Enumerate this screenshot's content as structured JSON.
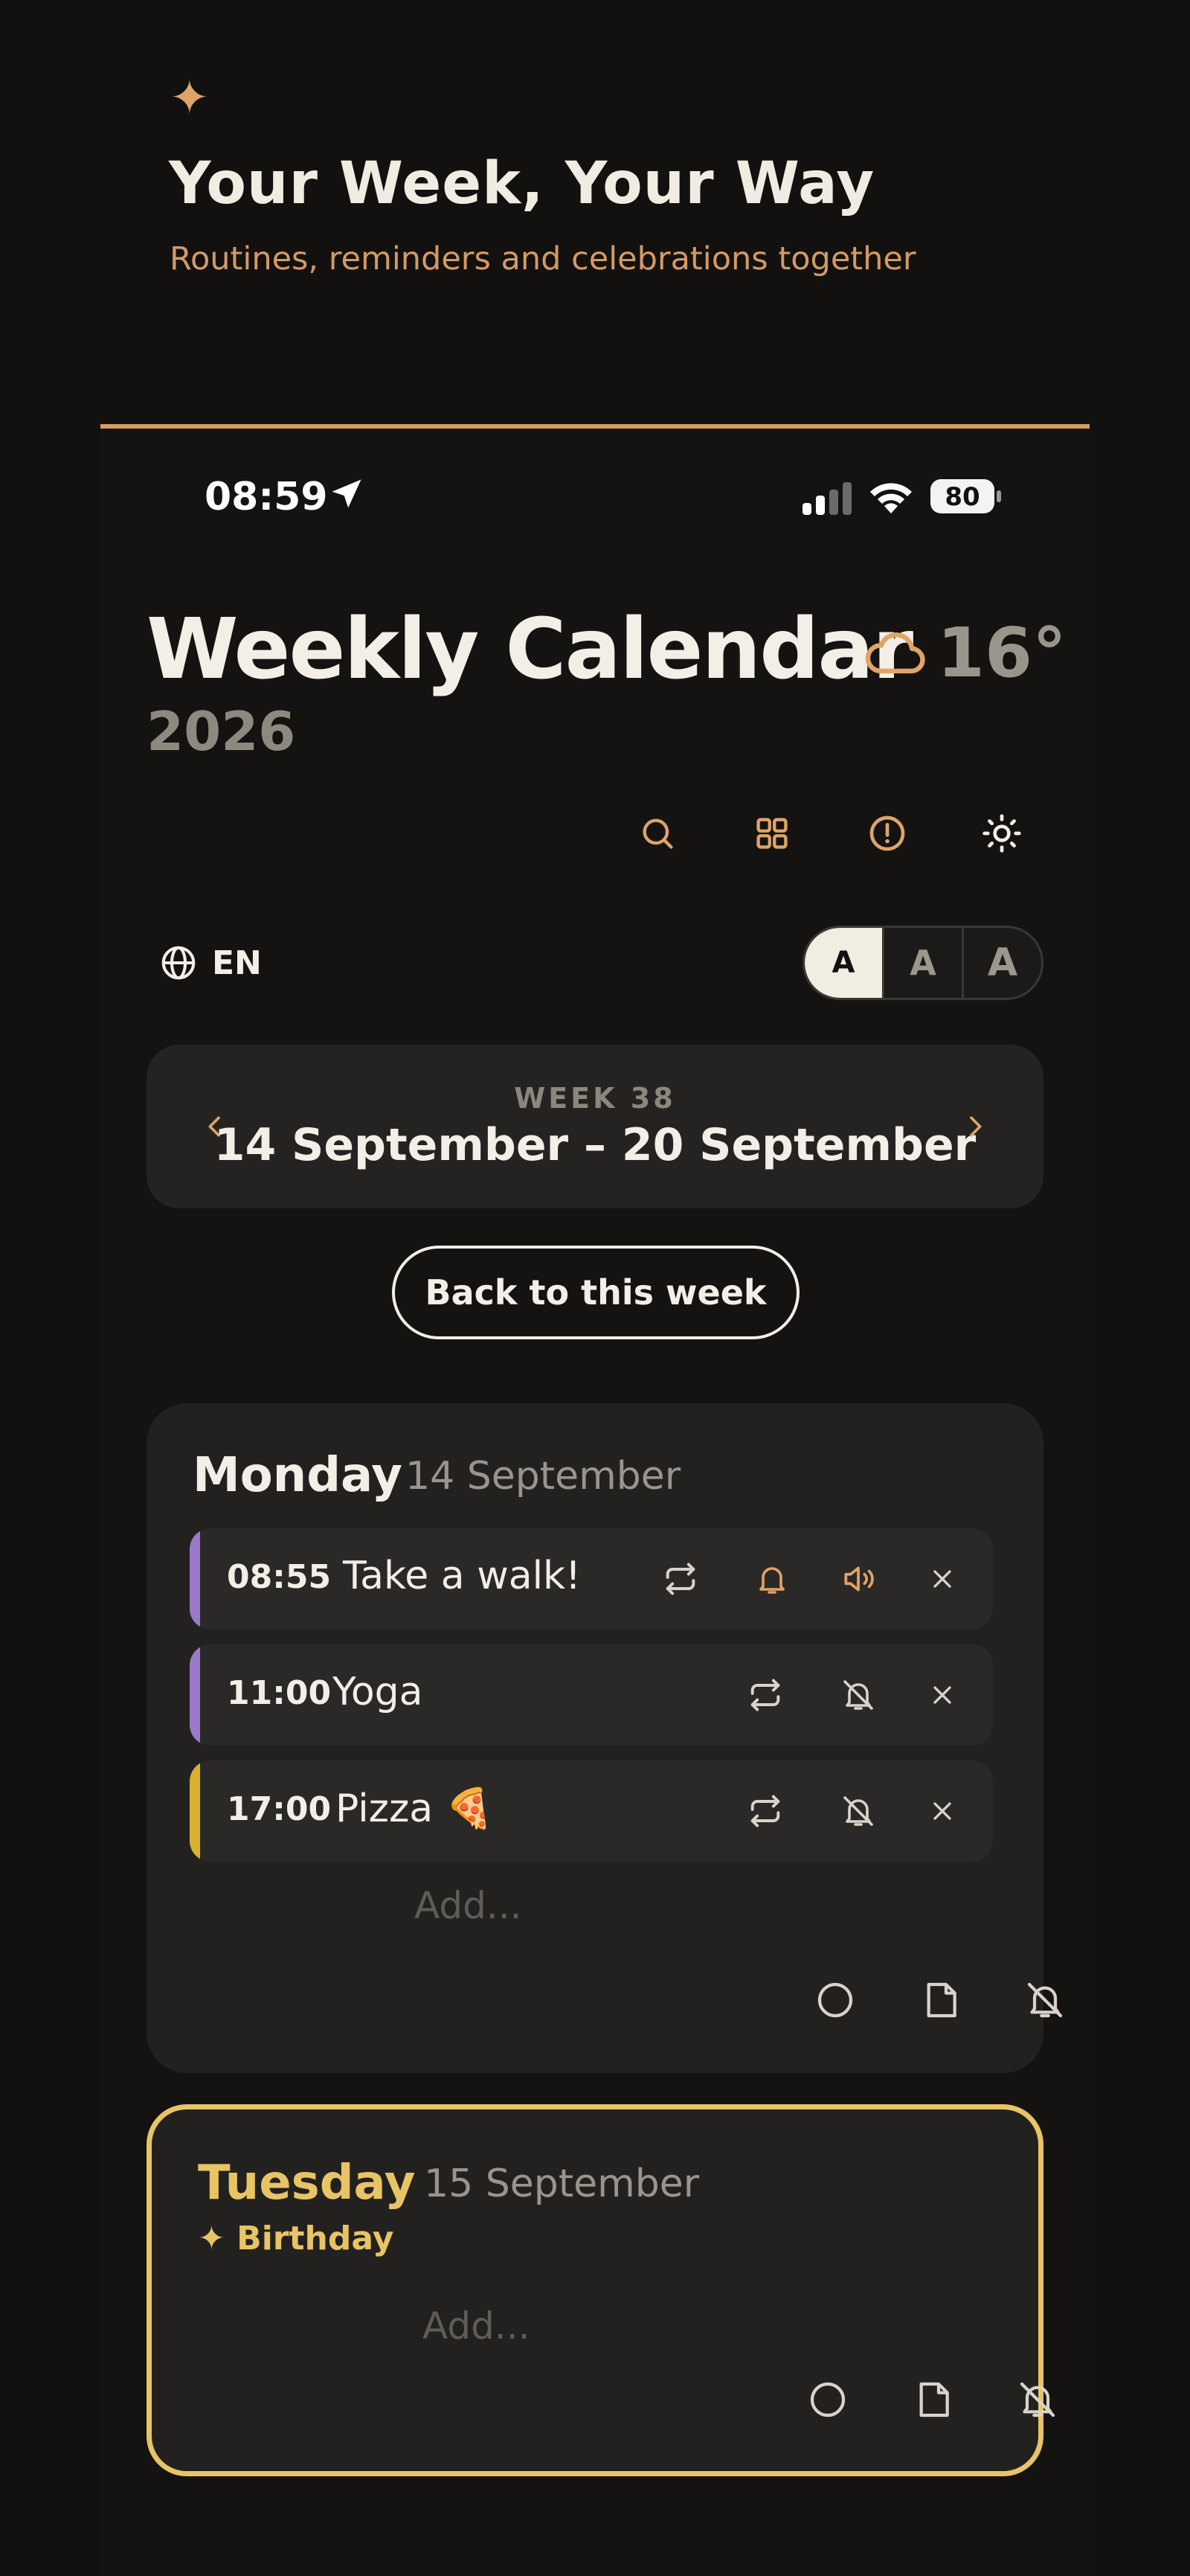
{
  "hero": {
    "sparkle": "✦",
    "title": "Your Week, Your Way",
    "subtitle": "Routines, reminders and celebrations together"
  },
  "status_bar": {
    "time": "08:59",
    "battery": "80"
  },
  "header": {
    "title": "Weekly Calendar",
    "year": "2026",
    "temperature": "16°",
    "weather_icon": "cloud-icon"
  },
  "toolbar": {
    "icons": [
      "search-icon",
      "grid-icon",
      "alert-icon",
      "sun-icon"
    ]
  },
  "language": {
    "label": "EN"
  },
  "font_size": {
    "options": [
      "A",
      "A",
      "A"
    ],
    "selected": 0
  },
  "week_nav": {
    "week_label": "WEEK 38",
    "range": "14 September – 20 September"
  },
  "back_button": "Back to this week",
  "days": [
    {
      "name": "Monday",
      "date": "14 September",
      "events": [
        {
          "time": "08:55",
          "title": "Take a walk!",
          "color": "#9a7ac7",
          "alarm": true,
          "sound": true
        },
        {
          "time": "11:00",
          "title": "Yoga",
          "color": "#9a7ac7",
          "alarm": false,
          "sound": false
        },
        {
          "time": "17:00",
          "title": "Pizza 🍕",
          "color": "#d8b12e",
          "alarm": false,
          "sound": false
        }
      ],
      "add_placeholder": "Add..."
    },
    {
      "name": "Tuesday",
      "date": "15 September",
      "badge": "✦ Birthday",
      "highlight_color": "#e8c465",
      "add_placeholder": "Add..."
    }
  ],
  "colors": {
    "accent": "#d99c62",
    "birthday": "#e8c465",
    "background": "#121110",
    "card": "#232120"
  }
}
